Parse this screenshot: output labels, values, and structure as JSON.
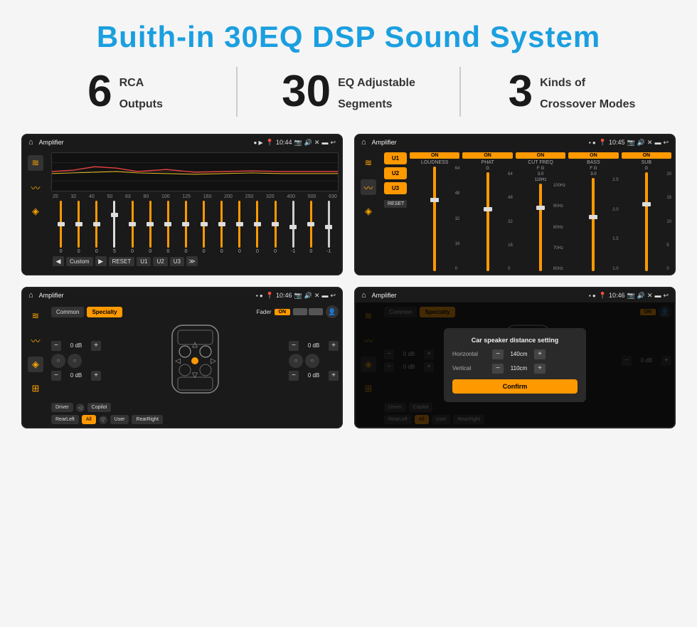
{
  "page": {
    "title": "Buith-in 30EQ DSP Sound System"
  },
  "stats": [
    {
      "number": "6",
      "label": "RCA",
      "sublabel": "Outputs"
    },
    {
      "number": "30",
      "label": "EQ Adjustable",
      "sublabel": "Segments"
    },
    {
      "number": "3",
      "label": "Kinds of",
      "sublabel": "Crossover Modes"
    }
  ],
  "screen1": {
    "app": "Amplifier",
    "time": "10:44",
    "freqs": [
      "25",
      "32",
      "40",
      "50",
      "63",
      "80",
      "100",
      "125",
      "160",
      "200",
      "250",
      "320",
      "400",
      "500",
      "630"
    ],
    "values": [
      "0",
      "0",
      "0",
      "5",
      "0",
      "0",
      "0",
      "0",
      "0",
      "0",
      "0",
      "0",
      "0",
      "-1",
      "0",
      "-1"
    ],
    "presets": [
      "Custom",
      "RESET",
      "U1",
      "U2",
      "U3"
    ]
  },
  "screen2": {
    "app": "Amplifier",
    "time": "10:45",
    "channels": [
      "LOUDNESS",
      "PHAT",
      "CUT FREQ",
      "BASS",
      "SUB"
    ],
    "channel_labels": [
      "U1",
      "U2",
      "U3"
    ]
  },
  "screen3": {
    "app": "Amplifier",
    "time": "10:46",
    "tabs": [
      "Common",
      "Specialty"
    ],
    "active_tab": "Specialty",
    "fader_label": "Fader",
    "fader_on": "ON",
    "volumes": [
      "0 dB",
      "0 dB",
      "0 dB",
      "0 dB"
    ],
    "bottom_buttons": [
      "Driver",
      "",
      "Copilot",
      "RearLeft",
      "All",
      "User",
      "RearRight"
    ]
  },
  "screen4": {
    "app": "Amplifier",
    "time": "10:46",
    "dialog": {
      "title": "Car speaker distance setting",
      "horizontal_label": "Horizontal",
      "horizontal_value": "140cm",
      "vertical_label": "Vertical",
      "vertical_value": "110cm",
      "confirm_label": "Confirm"
    },
    "tabs": [
      "Common",
      "Specialty"
    ],
    "volumes": [
      "0 dB",
      "0 dB"
    ],
    "bottom_buttons": [
      "Driver",
      "Copilot",
      "RearLeft",
      "All",
      "User",
      "RearRight"
    ]
  },
  "icons": {
    "home": "⌂",
    "eq": "≋",
    "wave": "∿",
    "speaker": "🔊",
    "play": "▶",
    "prev": "◀",
    "next": "▶",
    "pin": "📍",
    "camera": "📷",
    "volume": "🔊",
    "x": "✕",
    "back": "↩",
    "rect": "▬",
    "person": "👤"
  }
}
